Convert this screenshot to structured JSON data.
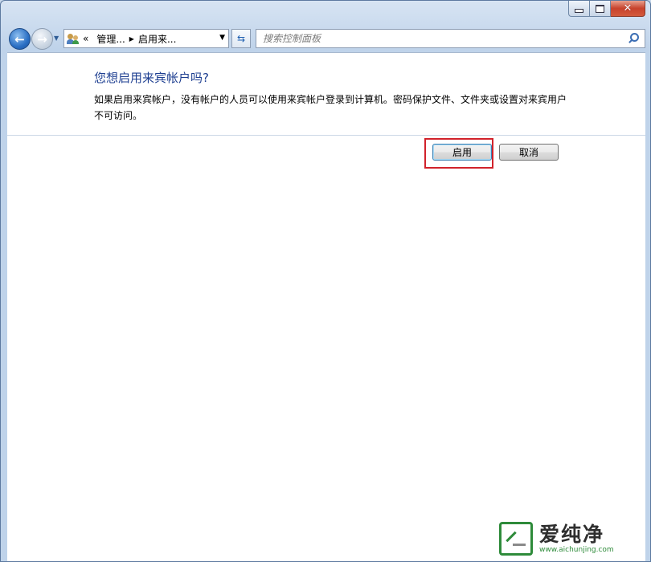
{
  "window": {
    "controls": {
      "minimize_icon": "minimize-icon",
      "maximize_icon": "maximize-icon",
      "close_icon": "close-icon"
    }
  },
  "nav": {
    "back_icon": "back-arrow-icon",
    "forward_icon": "forward-arrow-icon",
    "recent_icon": "chevron-down-icon",
    "breadcrumb": {
      "overflow": "«",
      "items": [
        "管理...",
        "启用来..."
      ]
    },
    "refresh_icon": "refresh-icon",
    "search": {
      "placeholder": "搜索控制面板",
      "value": ""
    }
  },
  "dialog": {
    "title": "您想启用来宾帐户吗?",
    "description": "如果启用来宾帐户，没有帐户的人员可以使用来宾帐户登录到计算机。密码保护文件、文件夹或设置对来宾用户不可访问。",
    "enable_label": "启用",
    "cancel_label": "取消"
  },
  "watermark": {
    "text": "爱纯净",
    "url": "www.aichunjing.com"
  },
  "colors": {
    "title_blue": "#1e3f91",
    "highlight_red": "#d1222b",
    "watermark_green": "#2e8b3a"
  }
}
